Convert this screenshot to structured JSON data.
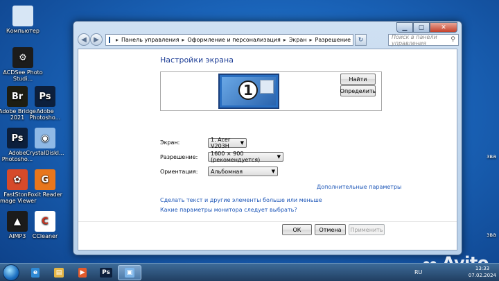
{
  "desktop": {
    "icons": [
      {
        "label": "Компьютер",
        "glyph": "",
        "color": "#d7e6f5"
      },
      {
        "label": "ACDSee Photo Studi...",
        "glyph": "⚙",
        "color": "#1c1c1c"
      },
      {
        "label": "Adobe Bridge 2021",
        "glyph": "Br",
        "color": "#1d1d12"
      },
      {
        "label": "Adobe Photosho...",
        "glyph": "Ps",
        "color": "#0c1f3c"
      },
      {
        "label": "Adobe Photosho...",
        "glyph": "Ps",
        "color": "#0c1f3c"
      },
      {
        "label": "CrystalDiskI...",
        "glyph": "◉",
        "color": "#8fb9e6"
      },
      {
        "label": "FastStone Image Viewer",
        "glyph": "✿",
        "color": "#d64a2a"
      },
      {
        "label": "Foxit Reader",
        "glyph": "G",
        "color": "#e8761c"
      },
      {
        "label": "AIMP3",
        "glyph": "▲",
        "color": "#1b1b1b"
      },
      {
        "label": "CCleaner",
        "glyph": "C",
        "color": "#ffffff"
      }
    ],
    "right_partial": [
      "зва",
      "зва"
    ]
  },
  "window": {
    "breadcrumb": [
      "Панель управления",
      "Оформление и персонализация",
      "Экран",
      "Разрешение экрана"
    ],
    "search_placeholder": "Поиск в панели управления",
    "title": "Настройки экрана",
    "monitor_number": "1",
    "buttons": {
      "find": "Найти",
      "detect": "Определить",
      "ok": "ОК",
      "cancel": "Отмена",
      "apply": "Применить"
    },
    "fields": {
      "screen_label": "Экран:",
      "screen_value": "1. Acer V203H",
      "resolution_label": "Разрешение:",
      "resolution_value": "1600 × 900 (рекомендуется)",
      "orientation_label": "Ориентация:",
      "orientation_value": "Альбомная"
    },
    "links": {
      "advanced": "Дополнительные параметры",
      "text_size": "Сделать текст и другие элементы больше или меньше",
      "which_settings": "Какие параметры монитора следует выбрать?"
    }
  },
  "taskbar": {
    "items": [
      {
        "glyph": "e",
        "color": "#2f8ad6"
      },
      {
        "glyph": "▤",
        "color": "#e5b647"
      },
      {
        "glyph": "▶",
        "color": "#e35a2b"
      },
      {
        "glyph": "Ps",
        "color": "#0c1f3c"
      },
      {
        "glyph": "▣",
        "color": "#7cb4e8"
      }
    ],
    "lang": "RU",
    "time": "13:33",
    "date": "07.02.2024"
  },
  "watermark": "Avito"
}
